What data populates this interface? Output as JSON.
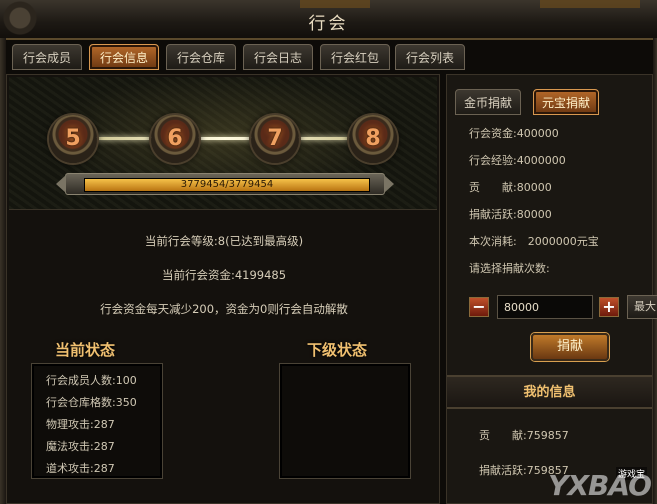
{
  "window": {
    "title": "行会"
  },
  "tabs": [
    {
      "label": "行会成员",
      "active": false
    },
    {
      "label": "行会信息",
      "active": true
    },
    {
      "label": "行会仓库",
      "active": false
    },
    {
      "label": "行会日志",
      "active": false
    },
    {
      "label": "行会红包",
      "active": false
    },
    {
      "label": "行会列表",
      "active": false
    }
  ],
  "levels": {
    "medals": [
      "5",
      "6",
      "7",
      "8"
    ],
    "progress_text": "3779454/3779454",
    "progress_fraction": 1.0
  },
  "info": {
    "current_level": "当前行会等级:8(已达到最高级)",
    "current_funds": "当前行会资金:4199485",
    "notice": "行会资金每天减少200，资金为0则行会自动解散"
  },
  "current_status": {
    "title": "当前状态",
    "rows": [
      "行会成员人数:100",
      "行会仓库格数:350",
      "物理攻击:287",
      "魔法攻击:287",
      "道术攻击:287"
    ]
  },
  "next_status": {
    "title": "下级状态"
  },
  "donate": {
    "tabs": [
      {
        "label": "金币捐献",
        "active": false
      },
      {
        "label": "元宝捐献",
        "active": true
      }
    ],
    "lines": [
      "行会资金:400000",
      "行会经验:4000000",
      "贡　　献:80000",
      "捐献活跃:80000",
      "本次消耗:　2000000元宝",
      "请选择捐献次数:"
    ],
    "quantity_value": "80000",
    "minus_label": "−",
    "plus_label": "+",
    "max_label": "最大",
    "donate_button": "捐献"
  },
  "my_info": {
    "title": "我的信息",
    "lines": [
      "贡　　献:759857",
      "捐献活跃:759857"
    ]
  },
  "watermark": {
    "text": "YXBAO",
    "sub": "游戏宝"
  },
  "colors": {
    "accent": "#f0c070",
    "active_tab": "#b66a2a",
    "progress": "#f6c24a"
  }
}
